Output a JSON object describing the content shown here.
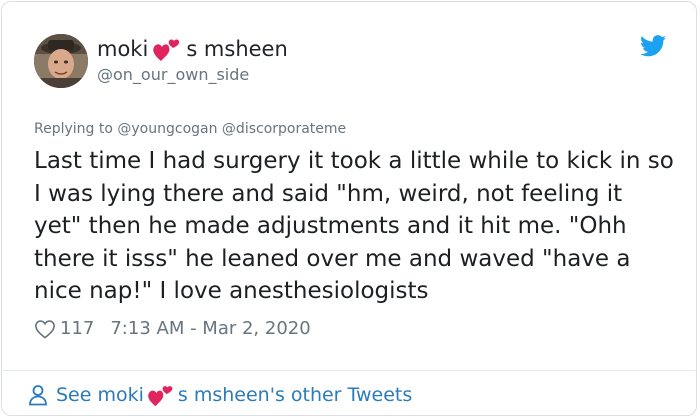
{
  "author": {
    "name_before": "moki",
    "name_emoji": "two-hearts-icon",
    "name_after": "s msheen",
    "handle": "@on_our_own_side"
  },
  "reply": {
    "prefix": "Replying to",
    "handles": "@youngcogan @discorporateme"
  },
  "tweet": {
    "text": "Last time I had surgery it took a little while to kick in so I was lying there and said \"hm, weird, not feeling it yet\" then he made adjustments and it hit me. \"Ohh there it isss\" he leaned over me and waved \"have a nice nap!\" I love anesthesiologists"
  },
  "meta": {
    "like_icon": "heart-outline-icon",
    "likes": "117",
    "timestamp": "7:13 AM - Mar 2, 2020"
  },
  "footer": {
    "icon": "person-icon",
    "label_before": "See moki",
    "label_after": "s msheen's other Tweets"
  },
  "colors": {
    "link": "#2b7bb9",
    "twitter_blue": "#1da1f2",
    "heart_red": "#e0245e",
    "muted": "#66757f",
    "text": "#1c2022"
  }
}
